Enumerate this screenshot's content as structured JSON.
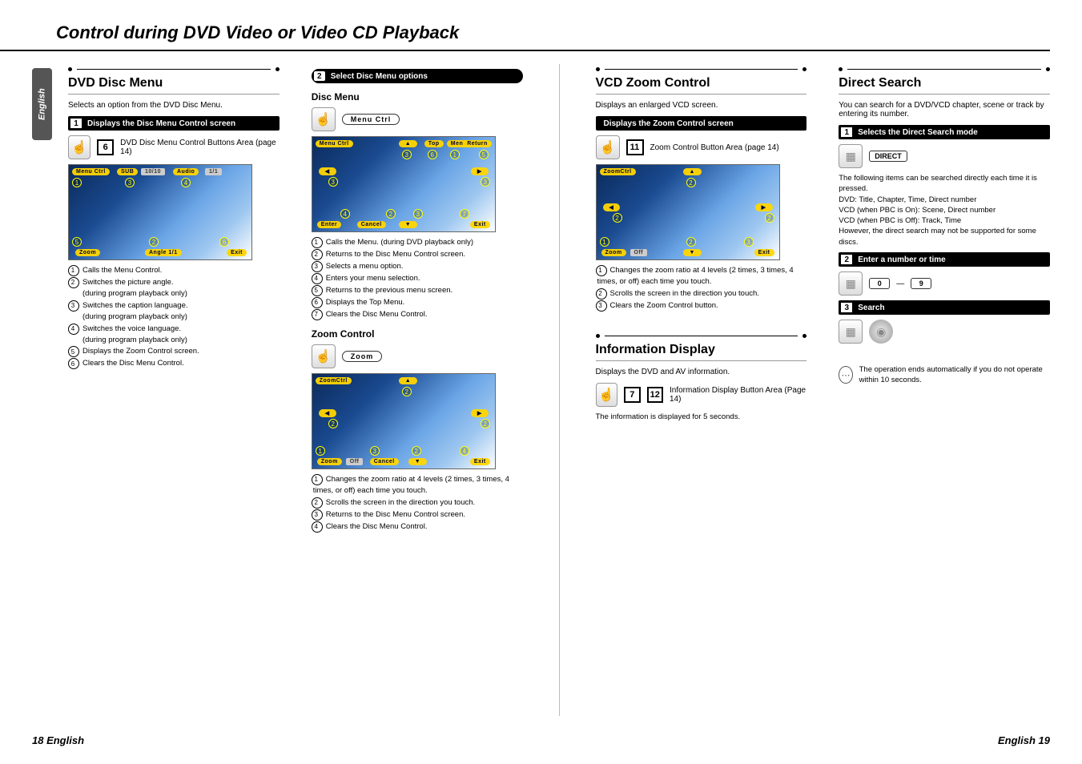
{
  "page_title": "Control during DVD Video or Video CD Playback",
  "side_tab": "English",
  "footer_left": "18 English",
  "footer_right": "English 19",
  "col1": {
    "section_title": "DVD Disc Menu",
    "section_desc": "Selects an option from the DVD Disc Menu.",
    "step1": {
      "num": "1",
      "label": "Displays the Disc Menu Control screen"
    },
    "iconrow1": {
      "box": "6",
      "caption": "DVD Disc Menu Control Buttons Area (page 14)"
    },
    "screen1": {
      "labels": {
        "menuctrl": "Menu Ctrl",
        "sub": "SUB",
        "subval": "10/10",
        "audio": "Audio",
        "audioval": "1/1",
        "zoom": "Zoom",
        "angle": "Angle 1/1",
        "exit": "Exit"
      }
    },
    "notes1": [
      "Calls the Menu Control.",
      "Switches the picture angle.|(during program playback only)",
      "Switches the caption language.|(during program playback only)",
      "Switches the voice language.|(during program playback only)",
      "Displays the Zoom Control screen.",
      "Clears the Disc Menu Control."
    ]
  },
  "col2": {
    "step2": {
      "num": "2",
      "label": "Select Disc Menu options"
    },
    "sub_disc": "Disc Menu",
    "btn_menuctrl": "Menu Ctrl",
    "screen2": {
      "labels": {
        "menuctrl": "Menu Ctrl",
        "top": "Top",
        "menu": "Menu",
        "return": "Return",
        "enter": "Enter",
        "cancel": "Cancel",
        "exit": "Exit"
      }
    },
    "notes2": [
      "Calls the Menu. (during DVD playback only)",
      "Returns to the Disc Menu Control screen.",
      "Selects a menu option.",
      "Enters your menu selection.",
      "Returns to the previous menu screen.",
      "Displays the Top Menu.",
      "Clears the Disc Menu Control."
    ],
    "sub_zoom": "Zoom Control",
    "btn_zoom": "Zoom",
    "screen3": {
      "labels": {
        "zoomctrl": "ZoomCtrl",
        "zoom": "Zoom",
        "off": "Off",
        "cancel": "Cancel",
        "exit": "Exit"
      }
    },
    "notes3": [
      "Changes the zoom ratio at 4 levels (2 times, 3 times, 4 times, or off) each time you touch.",
      "Scrolls the screen in the direction you touch.",
      "Returns to the Disc Menu Control screen.",
      "Clears the Disc Menu Control."
    ]
  },
  "col3": {
    "vcd_title": "VCD Zoom Control",
    "vcd_desc": "Displays an enlarged VCD screen.",
    "step_vcd": {
      "num": "",
      "label": "Displays the Zoom Control screen"
    },
    "iconrow_vcd": {
      "box": "11",
      "caption": "Zoom Control Button Area (page 14)"
    },
    "screen_vcd": {
      "labels": {
        "zoomctrl": "ZoomCtrl",
        "zoom": "Zoom",
        "off": "Off",
        "exit": "Exit"
      }
    },
    "notes_vcd": [
      "Changes the zoom ratio at 4 levels (2 times, 3 times, 4 times, or off) each time you touch.",
      "Scrolls the screen in the direction you touch.",
      "Clears the Zoom Control button."
    ],
    "info_title": "Information Display",
    "info_desc": "Displays the DVD and AV information.",
    "info_box1": "7",
    "info_box2": "12",
    "info_caption": "Information Display Button Area (Page 14)",
    "info_note": "The information is displayed for 5 seconds."
  },
  "col4": {
    "ds_title": "Direct Search",
    "ds_desc": "You can search for a DVD/VCD chapter, scene or track by entering its number.",
    "step1": {
      "num": "1",
      "label": "Selects the Direct Search mode"
    },
    "btn_direct": "DIRECT",
    "ds_note": "The following items can be searched directly each time it is pressed.\nDVD: Title, Chapter, Time, Direct number\nVCD (when PBC is On): Scene, Direct number\nVCD (when PBC is Off): Track, Time\nHowever, the direct search may not be supported for some discs.",
    "step2": {
      "num": "2",
      "label": "Enter a number or time"
    },
    "key0": "0",
    "key9": "9",
    "step3": {
      "num": "3",
      "label": "Search"
    },
    "final_note": "The operation ends automatically if you do not operate within 10 seconds."
  }
}
